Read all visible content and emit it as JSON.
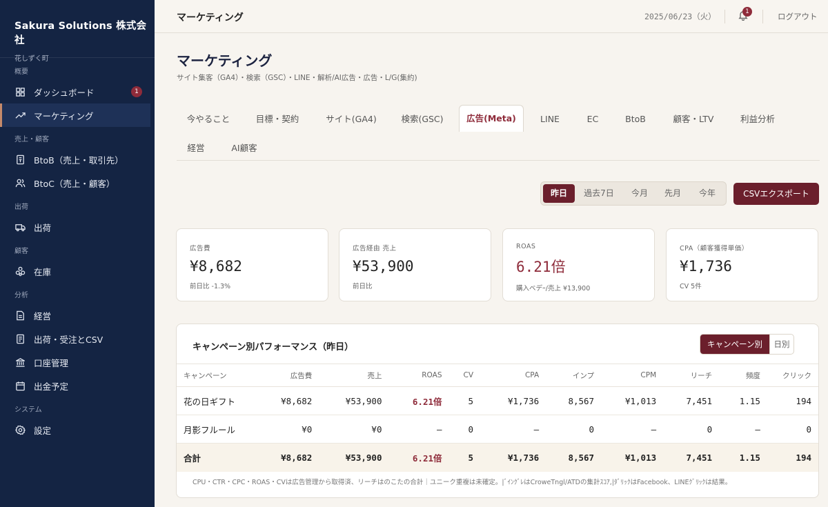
{
  "sidebar": {
    "company": "Sakura Solutions 株式会社",
    "store": "花しずく町",
    "sections": {
      "overview": "概要",
      "sales": "売上・顧客",
      "shipping": "出荷",
      "customers": "顧客",
      "analysis": "分析",
      "system": "システム"
    },
    "items": {
      "dashboard": "ダッシュボード",
      "dashboard_badge": "1",
      "marketing": "マーケティング",
      "btob": "BtoB（売上・取引先）",
      "btoc": "BtoC（売上・顧客）",
      "shipping": "出荷",
      "inventory": "在庫",
      "management": "経営",
      "orders_csv": "出荷・受注とCSV",
      "accounts": "口座管理",
      "payouts": "出金予定",
      "settings": "設定"
    }
  },
  "topbar": {
    "title": "マーケティング",
    "date": "2025/06/23（火）",
    "notification_count": "1",
    "logout": "ログアウト"
  },
  "page": {
    "title": "マーケティング",
    "subtitle": "サイト集客（GA4）・検索（GSC）・LINE・解析/AI広告・広告・L/G(集約)"
  },
  "tabs": [
    "今やること",
    "目標・契約",
    "サイト(GA4)",
    "検索(GSC)",
    "広告(Meta)",
    "LINE",
    "EC",
    "BtoB",
    "顧客・LTV",
    "利益分析",
    "経営",
    "AI顧客"
  ],
  "active_tab": "広告(Meta)",
  "range": [
    "昨日",
    "過去7日",
    "今月",
    "先月",
    "今年"
  ],
  "active_range": "昨日",
  "csv_export": "CSVエクスポート",
  "kpis": [
    {
      "label": "広告費",
      "value": "¥8,682",
      "note": "前日比 -1.3%"
    },
    {
      "label": "広告経由 売上",
      "value": "¥53,900",
      "note": "前日比"
    },
    {
      "label": "ROAS",
      "value": "6.21倍",
      "note": "購入ベデｰ/売上 ¥13,900"
    },
    {
      "label": "CPA（顧客獲得単価）",
      "value": "¥1,736",
      "note": "CV 5件"
    }
  ],
  "campaign_panel": {
    "title": "キャンペーン別パフォーマンス（昨日）",
    "toggle": [
      "キャンペーン別",
      "日別"
    ],
    "columns": [
      "キャンペーン",
      "広告費",
      "売上",
      "ROAS",
      "CV",
      "CPA",
      "インプ",
      "CPM",
      "リーチ",
      "頻度",
      "クリック"
    ],
    "rows": [
      [
        "花の日ギフト",
        "¥8,682",
        "¥53,900",
        "6.21倍",
        "5",
        "¥1,736",
        "8,567",
        "¥1,013",
        "7,451",
        "1.15",
        "194"
      ],
      [
        "月影フルール",
        "¥0",
        "¥0",
        "—",
        "0",
        "—",
        "0",
        "—",
        "0",
        "—",
        "0"
      ]
    ],
    "total": [
      "合計",
      "¥8,682",
      "¥53,900",
      "6.21倍",
      "5",
      "¥1,736",
      "8,567",
      "¥1,013",
      "7,451",
      "1.15",
      "194"
    ],
    "footnote": "CPU・CTR・CPC・ROAS・CVは広告管理から取得済、リーチはのこたの合計｜ユニーク重複は未確定。|ﾞｲﾝｸﾞﾚはCroweTngl/ATDの集計ｽｺｱ,|ﾀﾞﾘｯｸはFacebook、LINEｸﾞﾘｯｸは結果。"
  }
}
